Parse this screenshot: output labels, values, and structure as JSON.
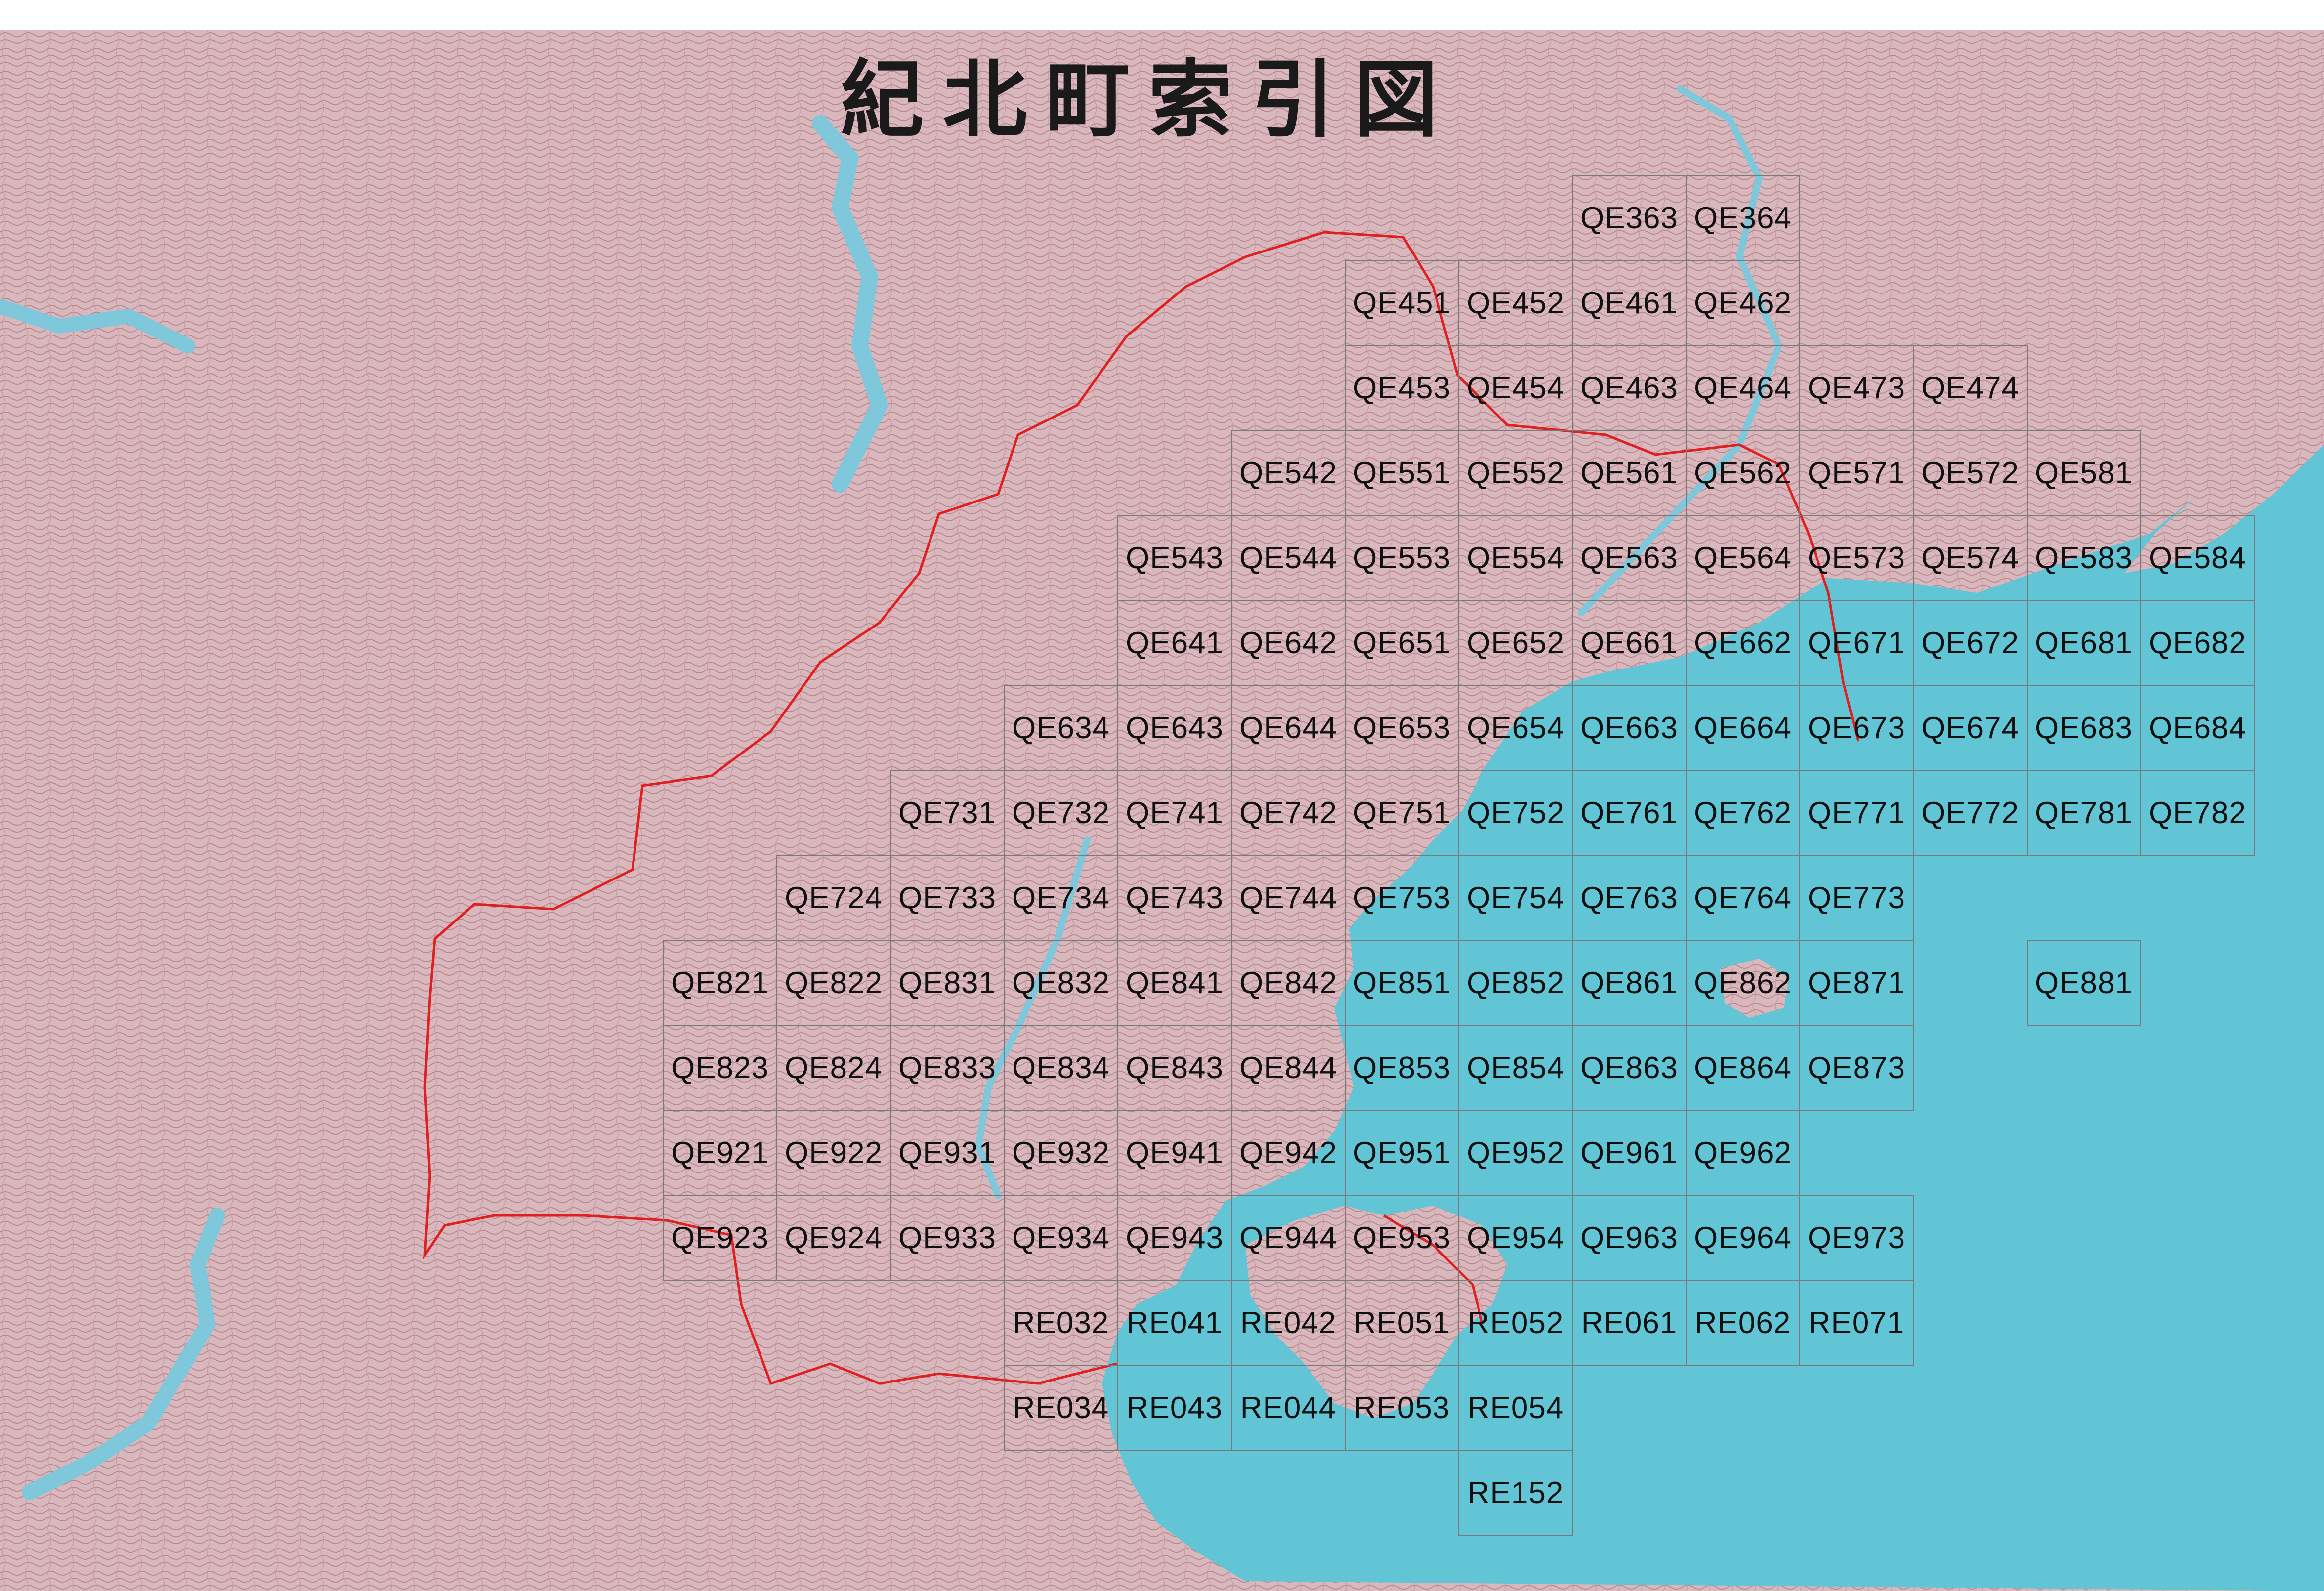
{
  "map": {
    "title": "紀北町索引図",
    "colors": {
      "sea": "#62c5d6",
      "land": "#d6b3b8",
      "terrain_lines": "#b07c86",
      "grid": "#7a7a7a",
      "boundary": "#e02020",
      "river": "#7fc8dc"
    }
  },
  "index_cells": [
    {
      "label": "QE363",
      "col": 11,
      "row": 0
    },
    {
      "label": "QE364",
      "col": 12,
      "row": 0
    },
    {
      "label": "QE451",
      "col": 9,
      "row": 1
    },
    {
      "label": "QE452",
      "col": 10,
      "row": 1
    },
    {
      "label": "QE461",
      "col": 11,
      "row": 1
    },
    {
      "label": "QE462",
      "col": 12,
      "row": 1
    },
    {
      "label": "QE453",
      "col": 9,
      "row": 2
    },
    {
      "label": "QE454",
      "col": 10,
      "row": 2
    },
    {
      "label": "QE463",
      "col": 11,
      "row": 2
    },
    {
      "label": "QE464",
      "col": 12,
      "row": 2
    },
    {
      "label": "QE473",
      "col": 13,
      "row": 2
    },
    {
      "label": "QE474",
      "col": 14,
      "row": 2
    },
    {
      "label": "QE542",
      "col": 8,
      "row": 3
    },
    {
      "label": "QE551",
      "col": 9,
      "row": 3
    },
    {
      "label": "QE552",
      "col": 10,
      "row": 3
    },
    {
      "label": "QE561",
      "col": 11,
      "row": 3
    },
    {
      "label": "QE562",
      "col": 12,
      "row": 3
    },
    {
      "label": "QE571",
      "col": 13,
      "row": 3
    },
    {
      "label": "QE572",
      "col": 14,
      "row": 3
    },
    {
      "label": "QE581",
      "col": 15,
      "row": 3
    },
    {
      "label": "QE543",
      "col": 7,
      "row": 4
    },
    {
      "label": "QE544",
      "col": 8,
      "row": 4
    },
    {
      "label": "QE553",
      "col": 9,
      "row": 4
    },
    {
      "label": "QE554",
      "col": 10,
      "row": 4
    },
    {
      "label": "QE563",
      "col": 11,
      "row": 4
    },
    {
      "label": "QE564",
      "col": 12,
      "row": 4
    },
    {
      "label": "QE573",
      "col": 13,
      "row": 4
    },
    {
      "label": "QE574",
      "col": 14,
      "row": 4
    },
    {
      "label": "QE583",
      "col": 15,
      "row": 4
    },
    {
      "label": "QE584",
      "col": 16,
      "row": 4
    },
    {
      "label": "QE641",
      "col": 7,
      "row": 5
    },
    {
      "label": "QE642",
      "col": 8,
      "row": 5
    },
    {
      "label": "QE651",
      "col": 9,
      "row": 5
    },
    {
      "label": "QE652",
      "col": 10,
      "row": 5
    },
    {
      "label": "QE661",
      "col": 11,
      "row": 5
    },
    {
      "label": "QE662",
      "col": 12,
      "row": 5
    },
    {
      "label": "QE671",
      "col": 13,
      "row": 5
    },
    {
      "label": "QE672",
      "col": 14,
      "row": 5
    },
    {
      "label": "QE681",
      "col": 15,
      "row": 5
    },
    {
      "label": "QE682",
      "col": 16,
      "row": 5
    },
    {
      "label": "QE634",
      "col": 6,
      "row": 6
    },
    {
      "label": "QE643",
      "col": 7,
      "row": 6
    },
    {
      "label": "QE644",
      "col": 8,
      "row": 6
    },
    {
      "label": "QE653",
      "col": 9,
      "row": 6
    },
    {
      "label": "QE654",
      "col": 10,
      "row": 6
    },
    {
      "label": "QE663",
      "col": 11,
      "row": 6
    },
    {
      "label": "QE664",
      "col": 12,
      "row": 6
    },
    {
      "label": "QE673",
      "col": 13,
      "row": 6
    },
    {
      "label": "QE674",
      "col": 14,
      "row": 6
    },
    {
      "label": "QE683",
      "col": 15,
      "row": 6
    },
    {
      "label": "QE684",
      "col": 16,
      "row": 6
    },
    {
      "label": "QE731",
      "col": 5,
      "row": 7
    },
    {
      "label": "QE732",
      "col": 6,
      "row": 7
    },
    {
      "label": "QE741",
      "col": 7,
      "row": 7
    },
    {
      "label": "QE742",
      "col": 8,
      "row": 7
    },
    {
      "label": "QE751",
      "col": 9,
      "row": 7
    },
    {
      "label": "QE752",
      "col": 10,
      "row": 7
    },
    {
      "label": "QE761",
      "col": 11,
      "row": 7
    },
    {
      "label": "QE762",
      "col": 12,
      "row": 7
    },
    {
      "label": "QE771",
      "col": 13,
      "row": 7
    },
    {
      "label": "QE772",
      "col": 14,
      "row": 7
    },
    {
      "label": "QE781",
      "col": 15,
      "row": 7
    },
    {
      "label": "QE782",
      "col": 16,
      "row": 7
    },
    {
      "label": "QE724",
      "col": 4,
      "row": 8
    },
    {
      "label": "QE733",
      "col": 5,
      "row": 8
    },
    {
      "label": "QE734",
      "col": 6,
      "row": 8
    },
    {
      "label": "QE743",
      "col": 7,
      "row": 8
    },
    {
      "label": "QE744",
      "col": 8,
      "row": 8
    },
    {
      "label": "QE753",
      "col": 9,
      "row": 8
    },
    {
      "label": "QE754",
      "col": 10,
      "row": 8
    },
    {
      "label": "QE763",
      "col": 11,
      "row": 8
    },
    {
      "label": "QE764",
      "col": 12,
      "row": 8
    },
    {
      "label": "QE773",
      "col": 13,
      "row": 8
    },
    {
      "label": "QE821",
      "col": 3,
      "row": 9
    },
    {
      "label": "QE822",
      "col": 4,
      "row": 9
    },
    {
      "label": "QE831",
      "col": 5,
      "row": 9
    },
    {
      "label": "QE832",
      "col": 6,
      "row": 9
    },
    {
      "label": "QE841",
      "col": 7,
      "row": 9
    },
    {
      "label": "QE842",
      "col": 8,
      "row": 9
    },
    {
      "label": "QE851",
      "col": 9,
      "row": 9
    },
    {
      "label": "QE852",
      "col": 10,
      "row": 9
    },
    {
      "label": "QE861",
      "col": 11,
      "row": 9
    },
    {
      "label": "QE862",
      "col": 12,
      "row": 9
    },
    {
      "label": "QE871",
      "col": 13,
      "row": 9
    },
    {
      "label": "QE881",
      "col": 15,
      "row": 9
    },
    {
      "label": "QE823",
      "col": 3,
      "row": 10
    },
    {
      "label": "QE824",
      "col": 4,
      "row": 10
    },
    {
      "label": "QE833",
      "col": 5,
      "row": 10
    },
    {
      "label": "QE834",
      "col": 6,
      "row": 10
    },
    {
      "label": "QE843",
      "col": 7,
      "row": 10
    },
    {
      "label": "QE844",
      "col": 8,
      "row": 10
    },
    {
      "label": "QE853",
      "col": 9,
      "row": 10
    },
    {
      "label": "QE854",
      "col": 10,
      "row": 10
    },
    {
      "label": "QE863",
      "col": 11,
      "row": 10
    },
    {
      "label": "QE864",
      "col": 12,
      "row": 10
    },
    {
      "label": "QE873",
      "col": 13,
      "row": 10
    },
    {
      "label": "QE921",
      "col": 3,
      "row": 11
    },
    {
      "label": "QE922",
      "col": 4,
      "row": 11
    },
    {
      "label": "QE931",
      "col": 5,
      "row": 11
    },
    {
      "label": "QE932",
      "col": 6,
      "row": 11
    },
    {
      "label": "QE941",
      "col": 7,
      "row": 11
    },
    {
      "label": "QE942",
      "col": 8,
      "row": 11
    },
    {
      "label": "QE951",
      "col": 9,
      "row": 11
    },
    {
      "label": "QE952",
      "col": 10,
      "row": 11
    },
    {
      "label": "QE961",
      "col": 11,
      "row": 11
    },
    {
      "label": "QE962",
      "col": 12,
      "row": 11
    },
    {
      "label": "QE923",
      "col": 3,
      "row": 12
    },
    {
      "label": "QE924",
      "col": 4,
      "row": 12
    },
    {
      "label": "QE933",
      "col": 5,
      "row": 12
    },
    {
      "label": "QE934",
      "col": 6,
      "row": 12
    },
    {
      "label": "QE943",
      "col": 7,
      "row": 12
    },
    {
      "label": "QE944",
      "col": 8,
      "row": 12
    },
    {
      "label": "QE953",
      "col": 9,
      "row": 12
    },
    {
      "label": "QE954",
      "col": 10,
      "row": 12
    },
    {
      "label": "QE963",
      "col": 11,
      "row": 12
    },
    {
      "label": "QE964",
      "col": 12,
      "row": 12
    },
    {
      "label": "QE973",
      "col": 13,
      "row": 12
    },
    {
      "label": "RE032",
      "col": 6,
      "row": 13
    },
    {
      "label": "RE041",
      "col": 7,
      "row": 13
    },
    {
      "label": "RE042",
      "col": 8,
      "row": 13
    },
    {
      "label": "RE051",
      "col": 9,
      "row": 13
    },
    {
      "label": "RE052",
      "col": 10,
      "row": 13
    },
    {
      "label": "RE061",
      "col": 11,
      "row": 13
    },
    {
      "label": "RE062",
      "col": 12,
      "row": 13
    },
    {
      "label": "RE071",
      "col": 13,
      "row": 13
    },
    {
      "label": "RE034",
      "col": 6,
      "row": 14
    },
    {
      "label": "RE043",
      "col": 7,
      "row": 14
    },
    {
      "label": "RE044",
      "col": 8,
      "row": 14
    },
    {
      "label": "RE053",
      "col": 9,
      "row": 14
    },
    {
      "label": "RE054",
      "col": 10,
      "row": 14
    },
    {
      "label": "RE152",
      "col": 10,
      "row": 15
    }
  ]
}
